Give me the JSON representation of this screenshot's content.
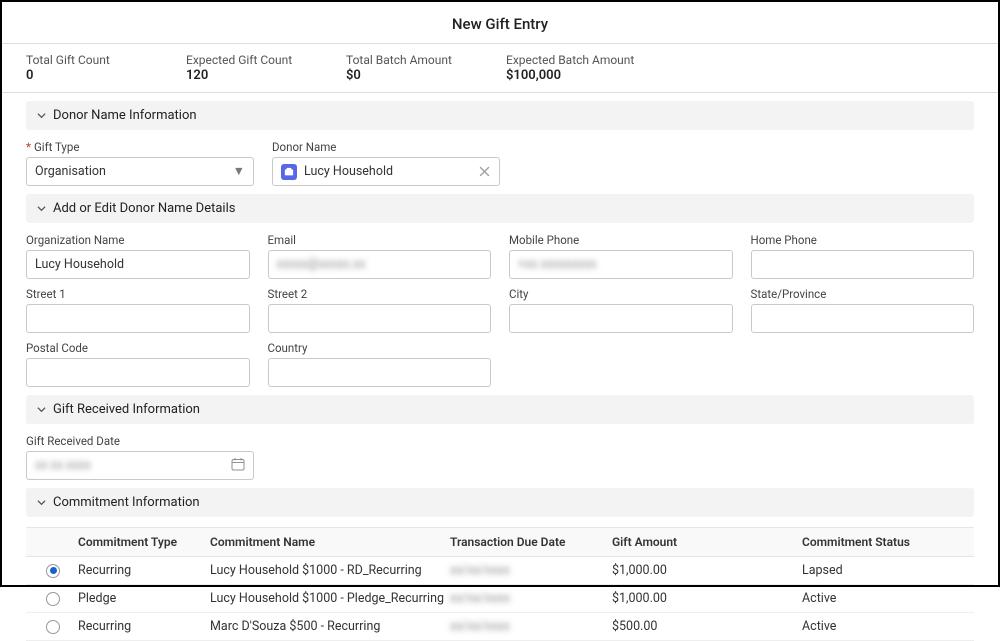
{
  "page_title": "New Gift Entry",
  "stats": {
    "total_gift_count": {
      "label": "Total Gift Count",
      "value": "0"
    },
    "expected_gift_count": {
      "label": "Expected Gift Count",
      "value": "120"
    },
    "total_batch_amount": {
      "label": "Total Batch Amount",
      "value": "$0"
    },
    "expected_batch_amount": {
      "label": "Expected Batch Amount",
      "value": "$100,000"
    }
  },
  "sections": {
    "donor_name_info": "Donor Name Information",
    "donor_details": "Add or Edit Donor Name Details",
    "gift_received": "Gift Received Information",
    "commitment": "Commitment Information"
  },
  "fields": {
    "gift_type": {
      "label": "Gift Type",
      "value": "Organisation"
    },
    "donor_name": {
      "label": "Donor Name",
      "value": "Lucy Household"
    },
    "org_name": {
      "label": "Organization Name",
      "value": "Lucy Household"
    },
    "email": {
      "label": "Email",
      "value": "xxxxx@xxxxx.xx"
    },
    "mobile": {
      "label": "Mobile Phone",
      "value": "+xx xxxxxxxxx"
    },
    "home_phone": {
      "label": "Home Phone",
      "value": ""
    },
    "street1": {
      "label": "Street 1",
      "value": ""
    },
    "street2": {
      "label": "Street 2",
      "value": ""
    },
    "city": {
      "label": "City",
      "value": ""
    },
    "state": {
      "label": "State/Province",
      "value": ""
    },
    "postal": {
      "label": "Postal Code",
      "value": ""
    },
    "country": {
      "label": "Country",
      "value": ""
    },
    "gift_received_date": {
      "label": "Gift Received Date",
      "value": "xx xx xxxx"
    }
  },
  "table": {
    "headers": {
      "type": "Commitment Type",
      "name": "Commitment Name",
      "date": "Transaction Due Date",
      "amount": "Gift Amount",
      "status": "Commitment Status"
    },
    "rows": [
      {
        "selected": true,
        "type": "Recurring",
        "name": "Lucy Household $1000 - RD_Recurring",
        "date": "xx/xx/xxxx",
        "amount": "$1,000.00",
        "status": "Lapsed"
      },
      {
        "selected": false,
        "type": "Pledge",
        "name": "Lucy Household $1000 - Pledge_Recurring",
        "date": "xx/xx/xxxx",
        "amount": "$1,000.00",
        "status": "Active"
      },
      {
        "selected": false,
        "type": "Recurring",
        "name": "Marc D'Souza $500 - Recurring",
        "date": "xx/xx/xxxx",
        "amount": "$500.00",
        "status": "Active"
      }
    ]
  }
}
